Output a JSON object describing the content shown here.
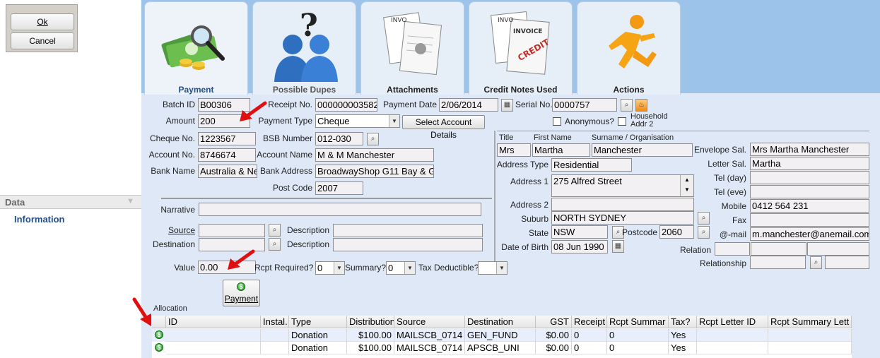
{
  "dialog": {
    "ok_label": "Ok",
    "cancel_label": "Cancel"
  },
  "left": {
    "section_label": "Data",
    "item_label": "Information"
  },
  "tabs": [
    {
      "label": "Payment"
    },
    {
      "label": "Possible Dupes"
    },
    {
      "label": "Attachments"
    },
    {
      "label": "Credit Notes Used"
    },
    {
      "label": "Actions"
    }
  ],
  "payment": {
    "batch_id_label": "Batch ID",
    "batch_id": "B00306",
    "receipt_no_label": "Receipt No.",
    "receipt_no": "000000003582",
    "payment_date_label": "Payment Date",
    "payment_date": "2/06/2014",
    "serial_no_label": "Serial No.",
    "serial_no": "0000757",
    "amount_label": "Amount",
    "amount": "200",
    "payment_type_label": "Payment Type",
    "payment_type": "Cheque",
    "select_account_label": "Select Account Details",
    "anonymous_label": "Anonymous?",
    "household_label": "Household Addr 2",
    "cheque_no_label": "Cheque No.",
    "cheque_no": "1223567",
    "bsb_label": "BSB Number",
    "bsb": "012-030",
    "account_no_label": "Account No.",
    "account_no": "8746674",
    "account_name_label": "Account Name",
    "account_name": "M & M Manchester",
    "bank_name_label": "Bank Name",
    "bank_name": "Australia & Ne",
    "bank_address_label": "Bank Address",
    "bank_address": "BroadwayShop G11  Bay & G",
    "post_code_label": "Post Code",
    "post_code": "2007",
    "narrative_label": "Narrative",
    "narrative": "",
    "source_label": "Source",
    "source": "",
    "destination_label": "Destination",
    "destination": "",
    "description_label": "Description",
    "value_label": "Value",
    "value": "0.00",
    "rcpt_required_label": "Rcpt Required?",
    "rcpt_required": "0",
    "summary_label": "Summary?",
    "summary": "0",
    "tax_deductible_label": "Tax Deductible?",
    "tax_deductible": "",
    "payment_button_label": "Payment"
  },
  "contact": {
    "title_label": "Title",
    "first_name_label": "First Name",
    "surname_label": "Surname / Organisation",
    "title": "Mrs",
    "first_name": "Martha",
    "surname": "Manchester",
    "address_type_label": "Address Type",
    "address_type": "Residential",
    "address1_label": "Address 1",
    "address1": "275 Alfred Street",
    "address2_label": "Address 2",
    "address2": "",
    "suburb_label": "Suburb",
    "suburb": "NORTH SYDNEY",
    "state_label": "State",
    "state": "NSW",
    "postcode_label": "Postcode",
    "postcode": "2060",
    "dob_label": "Date of Birth",
    "dob": "08 Jun 1990",
    "envelope_sal_label": "Envelope Sal.",
    "envelope_sal": "Mrs Martha Manchester",
    "letter_sal_label": "Letter Sal.",
    "letter_sal": "Martha",
    "tel_day_label": "Tel (day)",
    "tel_day": "",
    "tel_eve_label": "Tel (eve)",
    "tel_eve": "",
    "mobile_label": "Mobile",
    "mobile": "0412 564 231",
    "fax_label": "Fax",
    "fax": "",
    "email_label": "@-mail",
    "email": "m.manchester@anemail.com",
    "relation_label": "Relation",
    "relationship_label": "Relationship"
  },
  "allocation": {
    "label": "Allocation",
    "columns": [
      "ID",
      "Instal.",
      "Type",
      "Distribution",
      "Source",
      "Destination",
      "GST",
      "Receipt",
      "Rcpt Summar",
      "Tax?",
      "Rcpt Letter ID",
      "Rcpt Summary Lett"
    ],
    "rows": [
      {
        "id": "",
        "instal": "",
        "type": "Donation",
        "distribution": "$100.00",
        "source": "MAILSCB_0714",
        "destination": "GEN_FUND",
        "gst": "$0.00",
        "receipt": "0",
        "rcpt_summary": "0",
        "tax": "Yes",
        "rcpt_letter_id": "",
        "rcpt_summary_letter": ""
      },
      {
        "id": "",
        "instal": "",
        "type": "Donation",
        "distribution": "$100.00",
        "source": "MAILSCB_0714",
        "destination": "APSCB_UNI",
        "gst": "$0.00",
        "receipt": "0",
        "rcpt_summary": "0",
        "tax": "Yes",
        "rcpt_letter_id": "",
        "rcpt_summary_letter": ""
      }
    ]
  },
  "colors": {
    "tab_strip": "#9cc3ea",
    "form_bg": "#dee8f6",
    "accent": "#1f4e8c",
    "arrow": "#e01010"
  }
}
